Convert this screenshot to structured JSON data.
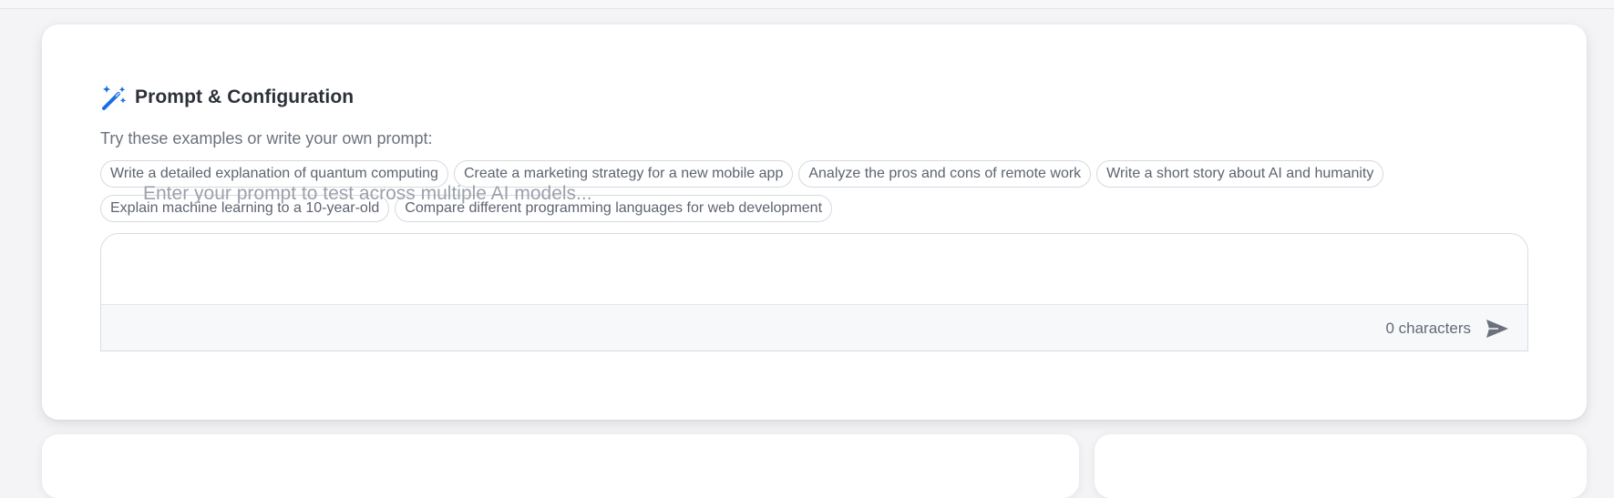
{
  "prompt_section": {
    "icon": "magic-wand-icon",
    "title": "Prompt & Configuration",
    "hint": "Try these examples or write your own prompt:",
    "examples": [
      "Write a detailed explanation of quantum computing",
      "Create a marketing strategy for a new mobile app",
      "Analyze the pros and cons of remote work",
      "Write a short story about AI and humanity",
      "Explain machine learning to a 10-year-old",
      "Compare different programming languages for web development"
    ],
    "prompt": {
      "value": "",
      "placeholder": "Enter your prompt to test across multiple AI models...",
      "char_count": "0 characters",
      "send_icon": "send-icon"
    }
  },
  "colors": {
    "accent": "#1a6fe0",
    "chip_border": "#d7d9de",
    "placeholder": "#9ba1ab"
  }
}
